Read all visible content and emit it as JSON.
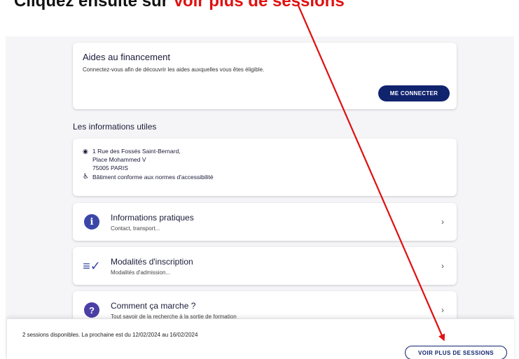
{
  "instruction": {
    "prefix": "Cliquez ensuite sur ",
    "highlight": "Voir plus de sessions"
  },
  "funding": {
    "title": "Aides au financement",
    "description": "Connectez-vous afin de découvrir les aides auxquelles vous êtes éligible.",
    "connect_label": "ME CONNECTER"
  },
  "useful_info": {
    "section_title": "Les informations utiles",
    "address_lines": [
      "1 Rue des Fossés Saint-Bernard,",
      "Place Mohammed V",
      "75005 PARIS"
    ],
    "accessibility": "Bâtiment conforme aux normes d'accessibilité"
  },
  "info_cards": [
    {
      "title": "Informations pratiques",
      "subtitle": "Contact, transport..."
    },
    {
      "title": "Modalités d'inscription",
      "subtitle": "Modalités d'admission..."
    },
    {
      "title": "Comment ça marche ?",
      "subtitle": "Tout savoir de la recherche à la sortie de formation"
    }
  ],
  "sessions": {
    "text": "2 sessions disponibles. La prochaine est du 12/02/2024 au 16/02/2024",
    "button_label": "VOIR PLUS DE SESSIONS"
  },
  "colors": {
    "primary": "#10236d",
    "annotation_red": "#e01010",
    "info_icon": "#3a47a8"
  }
}
